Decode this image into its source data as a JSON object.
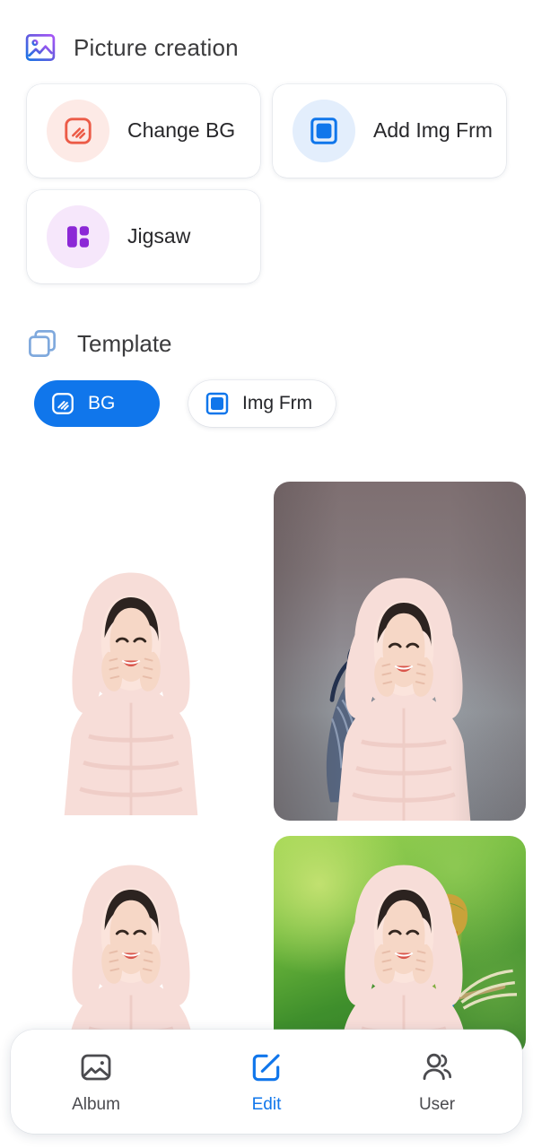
{
  "sections": {
    "picture_creation": {
      "title": "Picture creation",
      "icon": "picture-gradient-icon",
      "cards": [
        {
          "label": "Change BG",
          "icon": "change-bg-icon",
          "badge_color": "#fdeae6",
          "icon_color": "#ec5b47"
        },
        {
          "label": "Add Img Frm",
          "icon": "image-frame-icon",
          "badge_color": "#e3eefc",
          "icon_color": "#1076EB"
        },
        {
          "label": "Jigsaw",
          "icon": "jigsaw-icon",
          "badge_color": "#f6e7fb",
          "icon_color": "#8c28d6"
        }
      ]
    },
    "template": {
      "title": "Template",
      "icon": "template-layers-icon",
      "filters": [
        {
          "label": "BG",
          "icon": "change-bg-icon",
          "selected": true
        },
        {
          "label": "Img Frm",
          "icon": "image-frame-icon",
          "selected": false
        }
      ],
      "items": [
        {
          "name": "template-plain-white",
          "background": "white",
          "subject": "woman-pink-bunny-hood"
        },
        {
          "name": "template-heron-river",
          "background": "heron",
          "subject": "woman-pink-bunny-hood"
        },
        {
          "name": "template-plain-white-2",
          "background": "white",
          "subject": "woman-pink-bunny-hood"
        },
        {
          "name": "template-bee-eater",
          "background": "green",
          "subject": "woman-pink-bunny-hood"
        }
      ]
    }
  },
  "bottom_nav": {
    "items": [
      {
        "label": "Album",
        "icon": "photo-icon",
        "active": false
      },
      {
        "label": "Edit",
        "icon": "edit-square-pencil-icon",
        "active": true
      },
      {
        "label": "User",
        "icon": "users-icon",
        "active": false
      }
    ],
    "active_color": "#1076EB",
    "inactive_color": "#4b4b4f"
  }
}
